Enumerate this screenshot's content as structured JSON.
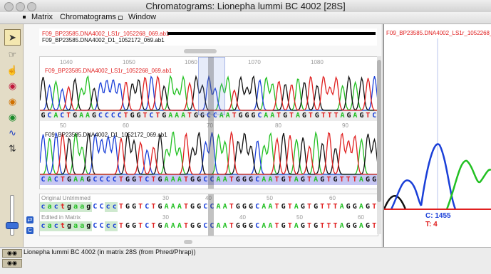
{
  "window": {
    "title": "Chromatograms: Lionepha lummi BC 4002 [28S]"
  },
  "menu": {
    "items": [
      "Matrix",
      "Chromatograms",
      "Window"
    ]
  },
  "toolbar": {
    "tools": [
      {
        "name": "arrow-tool",
        "icon": "arrow-cursor-icon",
        "glyph": "➤"
      },
      {
        "name": "hand-tool-1",
        "icon": "hand-icon",
        "glyph": "☞"
      },
      {
        "name": "hand-tool-2",
        "icon": "hand-pointer-icon",
        "glyph": "☝"
      },
      {
        "name": "eye-tool-1",
        "icon": "eye-red-icon",
        "glyph": "◉"
      },
      {
        "name": "eye-tool-2",
        "icon": "eye-orange-icon",
        "glyph": "◉"
      },
      {
        "name": "eye-tool-3",
        "icon": "eye-green-icon",
        "glyph": "◉"
      },
      {
        "name": "wave-tool",
        "icon": "wave-icon",
        "glyph": "∿"
      },
      {
        "name": "split-tool",
        "icon": "split-arrows-icon",
        "glyph": "⇅"
      }
    ]
  },
  "reads": {
    "read1": "F09_BP23585.DNA4002_LS1r_1052268_069.ab1",
    "read2": "F09_BP23585.DNA4002_D1_1052172_069.ab1"
  },
  "ruler_top": {
    "ticks": [
      "1040",
      "1050",
      "1060",
      "1070",
      "1080"
    ]
  },
  "ruler_mid": {
    "ticks": [
      "50",
      "60",
      "70",
      "80",
      "90"
    ]
  },
  "ruler_bottom": {
    "ticks": [
      "30",
      "40",
      "50",
      "60"
    ]
  },
  "ruler_edited": {
    "ticks": [
      "30",
      "40",
      "50",
      "60"
    ]
  },
  "sequences": {
    "read1_bases": "GCACTGAAGCCCCTGGTCTGAAATGGCCAATGGGCAATGTAGTGTTTAGAGTC",
    "read2_bases": "CACTGAAGCCCCTGGTCTGAAATGGCCAATGGGCAATGTAGTAGTGTTTAGG",
    "untrimmed_label": "Original Untrimmed",
    "untrimmed": "cactgaagCCccTGGTCTGAAATGGCCAATGGGCAATGTAGTGTTTAGGAGT",
    "edited_label": "Edited in Matrix",
    "edited": "cactgaagCCccTGGTCTGAAATGGCCAATGGGCAATGTAGTGTTTAGGAGT"
  },
  "peak_panel": {
    "read": "F09_BP23585.DNA4002_LS1r_1052268_069.ab1",
    "c_value": "C: 1455",
    "t_value": "T: 4"
  },
  "status": {
    "text": "Lionepha lummi BC 4002 (in matrix 28S (from Phred/Phrap))"
  },
  "colors": {
    "A": "#22c022",
    "C": "#1a3fd8",
    "G": "#111111",
    "T": "#e02020",
    "accent": "#e02020"
  }
}
